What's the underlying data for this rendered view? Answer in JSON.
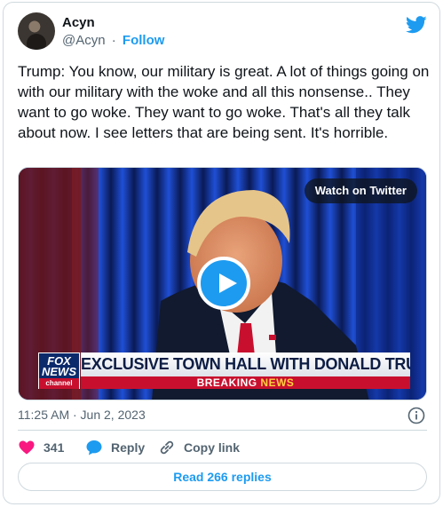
{
  "author": {
    "name": "Acyn",
    "handle": "@Acyn",
    "separator": "·",
    "follow_label": "Follow"
  },
  "tweet": {
    "text": "Trump: You know, our military is great. A lot of things going on with our military with the woke and all this nonsense.. They want to go woke. They want to go woke. That's all they talk about now. I see letters that are being sent. It's horrible.",
    "timestamp": "11:25 AM · Jun 2, 2023"
  },
  "media": {
    "watch_label": "Watch on Twitter",
    "fox_logo": {
      "line1": "FOX",
      "line2": "NEWS",
      "line3": "channel"
    },
    "headline": "EXCLUSIVE TOWN HALL WITH DONALD TRUMP",
    "breaking_prefix": "BREAKING",
    "breaking_word": "NEWS"
  },
  "actions": {
    "like_count": "341",
    "reply_label": "Reply",
    "copy_label": "Copy link"
  },
  "read_replies_label": "Read 266 replies",
  "colors": {
    "accent": "#1d9bf0",
    "like": "#f91880",
    "text_secondary": "#536471",
    "border": "#cfd9de",
    "fox_red": "#c8102e",
    "fox_navy": "#0b2a6b"
  },
  "icons": [
    "twitter-bird-icon",
    "play-icon",
    "info-icon",
    "heart-icon",
    "reply-bubble-icon",
    "link-icon"
  ]
}
